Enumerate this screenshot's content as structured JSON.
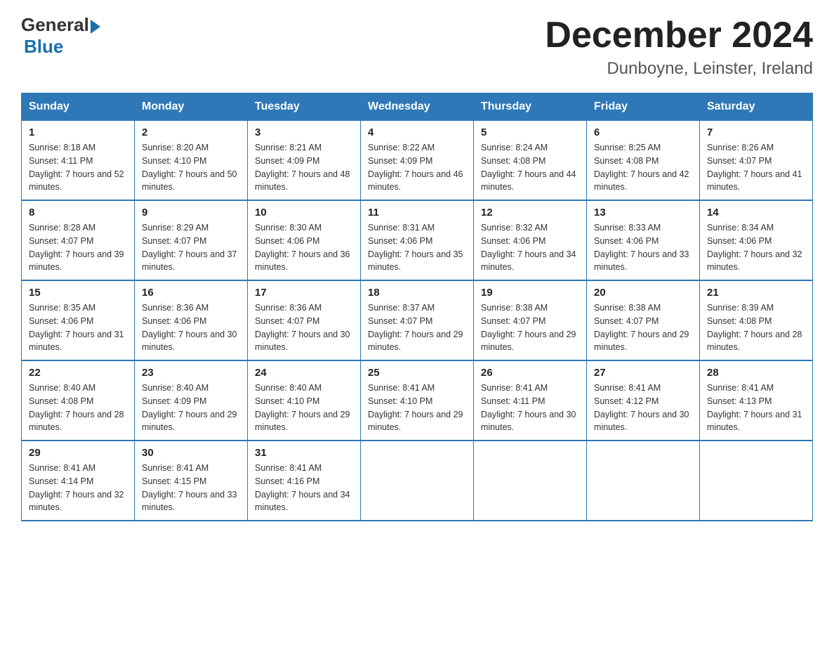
{
  "logo": {
    "text_general": "General",
    "text_blue": "Blue"
  },
  "title": {
    "month_year": "December 2024",
    "location": "Dunboyne, Leinster, Ireland"
  },
  "headers": [
    "Sunday",
    "Monday",
    "Tuesday",
    "Wednesday",
    "Thursday",
    "Friday",
    "Saturday"
  ],
  "weeks": [
    [
      {
        "day": "1",
        "sunrise": "8:18 AM",
        "sunset": "4:11 PM",
        "daylight": "7 hours and 52 minutes."
      },
      {
        "day": "2",
        "sunrise": "8:20 AM",
        "sunset": "4:10 PM",
        "daylight": "7 hours and 50 minutes."
      },
      {
        "day": "3",
        "sunrise": "8:21 AM",
        "sunset": "4:09 PM",
        "daylight": "7 hours and 48 minutes."
      },
      {
        "day": "4",
        "sunrise": "8:22 AM",
        "sunset": "4:09 PM",
        "daylight": "7 hours and 46 minutes."
      },
      {
        "day": "5",
        "sunrise": "8:24 AM",
        "sunset": "4:08 PM",
        "daylight": "7 hours and 44 minutes."
      },
      {
        "day": "6",
        "sunrise": "8:25 AM",
        "sunset": "4:08 PM",
        "daylight": "7 hours and 42 minutes."
      },
      {
        "day": "7",
        "sunrise": "8:26 AM",
        "sunset": "4:07 PM",
        "daylight": "7 hours and 41 minutes."
      }
    ],
    [
      {
        "day": "8",
        "sunrise": "8:28 AM",
        "sunset": "4:07 PM",
        "daylight": "7 hours and 39 minutes."
      },
      {
        "day": "9",
        "sunrise": "8:29 AM",
        "sunset": "4:07 PM",
        "daylight": "7 hours and 37 minutes."
      },
      {
        "day": "10",
        "sunrise": "8:30 AM",
        "sunset": "4:06 PM",
        "daylight": "7 hours and 36 minutes."
      },
      {
        "day": "11",
        "sunrise": "8:31 AM",
        "sunset": "4:06 PM",
        "daylight": "7 hours and 35 minutes."
      },
      {
        "day": "12",
        "sunrise": "8:32 AM",
        "sunset": "4:06 PM",
        "daylight": "7 hours and 34 minutes."
      },
      {
        "day": "13",
        "sunrise": "8:33 AM",
        "sunset": "4:06 PM",
        "daylight": "7 hours and 33 minutes."
      },
      {
        "day": "14",
        "sunrise": "8:34 AM",
        "sunset": "4:06 PM",
        "daylight": "7 hours and 32 minutes."
      }
    ],
    [
      {
        "day": "15",
        "sunrise": "8:35 AM",
        "sunset": "4:06 PM",
        "daylight": "7 hours and 31 minutes."
      },
      {
        "day": "16",
        "sunrise": "8:36 AM",
        "sunset": "4:06 PM",
        "daylight": "7 hours and 30 minutes."
      },
      {
        "day": "17",
        "sunrise": "8:36 AM",
        "sunset": "4:07 PM",
        "daylight": "7 hours and 30 minutes."
      },
      {
        "day": "18",
        "sunrise": "8:37 AM",
        "sunset": "4:07 PM",
        "daylight": "7 hours and 29 minutes."
      },
      {
        "day": "19",
        "sunrise": "8:38 AM",
        "sunset": "4:07 PM",
        "daylight": "7 hours and 29 minutes."
      },
      {
        "day": "20",
        "sunrise": "8:38 AM",
        "sunset": "4:07 PM",
        "daylight": "7 hours and 29 minutes."
      },
      {
        "day": "21",
        "sunrise": "8:39 AM",
        "sunset": "4:08 PM",
        "daylight": "7 hours and 28 minutes."
      }
    ],
    [
      {
        "day": "22",
        "sunrise": "8:40 AM",
        "sunset": "4:08 PM",
        "daylight": "7 hours and 28 minutes."
      },
      {
        "day": "23",
        "sunrise": "8:40 AM",
        "sunset": "4:09 PM",
        "daylight": "7 hours and 29 minutes."
      },
      {
        "day": "24",
        "sunrise": "8:40 AM",
        "sunset": "4:10 PM",
        "daylight": "7 hours and 29 minutes."
      },
      {
        "day": "25",
        "sunrise": "8:41 AM",
        "sunset": "4:10 PM",
        "daylight": "7 hours and 29 minutes."
      },
      {
        "day": "26",
        "sunrise": "8:41 AM",
        "sunset": "4:11 PM",
        "daylight": "7 hours and 30 minutes."
      },
      {
        "day": "27",
        "sunrise": "8:41 AM",
        "sunset": "4:12 PM",
        "daylight": "7 hours and 30 minutes."
      },
      {
        "day": "28",
        "sunrise": "8:41 AM",
        "sunset": "4:13 PM",
        "daylight": "7 hours and 31 minutes."
      }
    ],
    [
      {
        "day": "29",
        "sunrise": "8:41 AM",
        "sunset": "4:14 PM",
        "daylight": "7 hours and 32 minutes."
      },
      {
        "day": "30",
        "sunrise": "8:41 AM",
        "sunset": "4:15 PM",
        "daylight": "7 hours and 33 minutes."
      },
      {
        "day": "31",
        "sunrise": "8:41 AM",
        "sunset": "4:16 PM",
        "daylight": "7 hours and 34 minutes."
      },
      null,
      null,
      null,
      null
    ]
  ]
}
